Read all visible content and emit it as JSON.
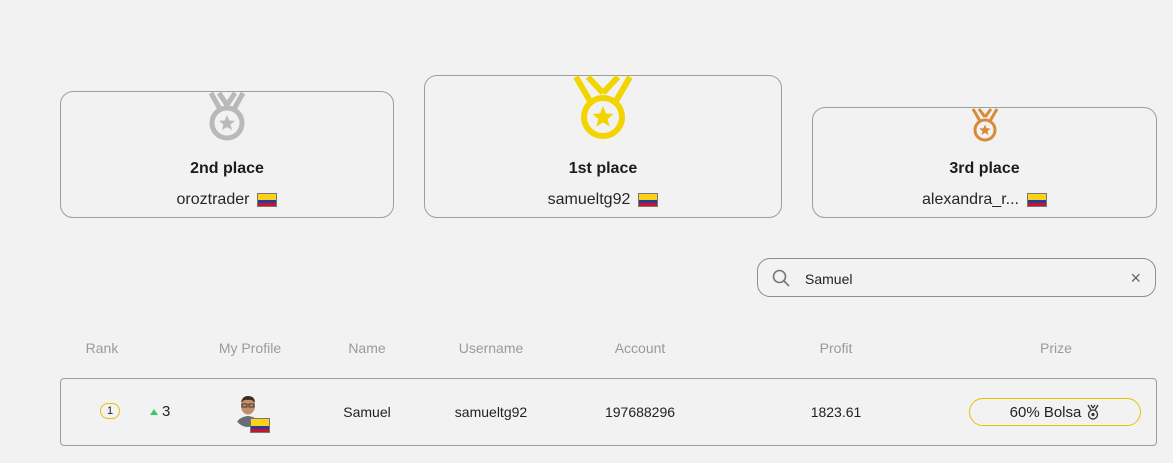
{
  "podium": {
    "second": {
      "place_label": "2nd place",
      "username": "oroztrader",
      "medal_color": "#b9b9b9",
      "medal_icon": "silver-medal-icon",
      "flag": "colombia-flag-icon"
    },
    "first": {
      "place_label": "1st place",
      "username": "samueltg92",
      "medal_color": "#f2d400",
      "medal_icon": "gold-medal-icon",
      "flag": "colombia-flag-icon"
    },
    "third": {
      "place_label": "3rd place",
      "username": "alexandra_r...",
      "medal_color": "#d88a3a",
      "medal_icon": "bronze-medal-icon",
      "flag": "colombia-flag-icon"
    }
  },
  "search": {
    "value": "Samuel",
    "placeholder": "",
    "icon": "search-icon",
    "clear_icon": "close-icon"
  },
  "table": {
    "headers": {
      "rank": "Rank",
      "profile": "My Profile",
      "name": "Name",
      "username": "Username",
      "account": "Account",
      "profit": "Profit",
      "prize": "Prize"
    },
    "rows": [
      {
        "rank": "1",
        "change": "3",
        "change_direction": "up",
        "name": "Samuel",
        "username": "samueltg92",
        "account": "197688296",
        "profit": "1823.61",
        "prize": "60% Bolsa",
        "prize_icon": "medal-icon"
      }
    ]
  },
  "colors": {
    "gold": "#f2d400",
    "silver": "#b9b9b9",
    "bronze": "#d88a3a",
    "up": "#3ec76a",
    "border": "#9e9e9e"
  }
}
